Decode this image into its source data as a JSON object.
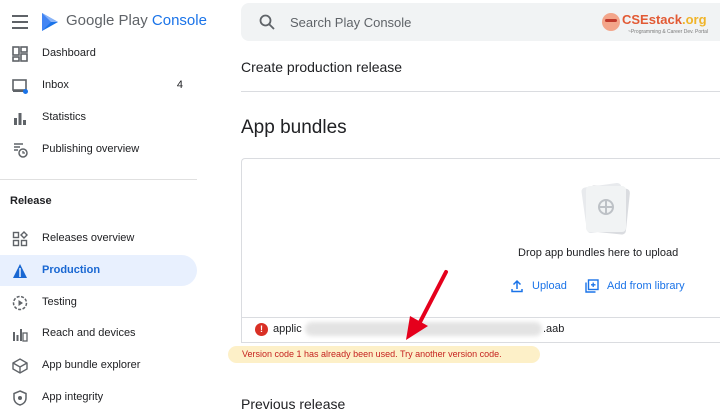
{
  "brand": {
    "google_play": "Google Play",
    "console": "Console"
  },
  "sidebar": {
    "items": [
      {
        "label": "Dashboard",
        "icon": "dashboard-icon"
      },
      {
        "label": "Inbox",
        "icon": "inbox-icon",
        "count": "4"
      },
      {
        "label": "Statistics",
        "icon": "statistics-icon"
      },
      {
        "label": "Publishing overview",
        "icon": "publishing-overview-icon"
      }
    ],
    "section_title": "Release",
    "release_items": [
      {
        "label": "Releases overview",
        "icon": "releases-overview-icon"
      },
      {
        "label": "Production",
        "icon": "production-icon",
        "active": true
      },
      {
        "label": "Testing",
        "icon": "testing-icon"
      },
      {
        "label": "Reach and devices",
        "icon": "reach-devices-icon"
      },
      {
        "label": "App bundle explorer",
        "icon": "app-bundle-explorer-icon"
      },
      {
        "label": "App integrity",
        "icon": "app-integrity-icon"
      }
    ]
  },
  "search": {
    "placeholder": "Search Play Console"
  },
  "watermark": {
    "name": "CSEstack",
    "tld": ".org",
    "tagline": "~Programming & Career Dev. Portal"
  },
  "page": {
    "header": "Create production release",
    "section_heading": "App bundles",
    "drop_text": "Drop app bundles here to upload",
    "upload_label": "Upload",
    "library_label": "Add from library",
    "file": {
      "prefix": "applic",
      "suffix": ".aab"
    },
    "error_message": "Version code 1 has already been used. Try another version code.",
    "previous_release": "Previous release"
  },
  "colors": {
    "accent": "#1a73e8",
    "error": "#d93025",
    "annotation_arrow": "#e5001c",
    "highlight": "#fdf0c8"
  }
}
